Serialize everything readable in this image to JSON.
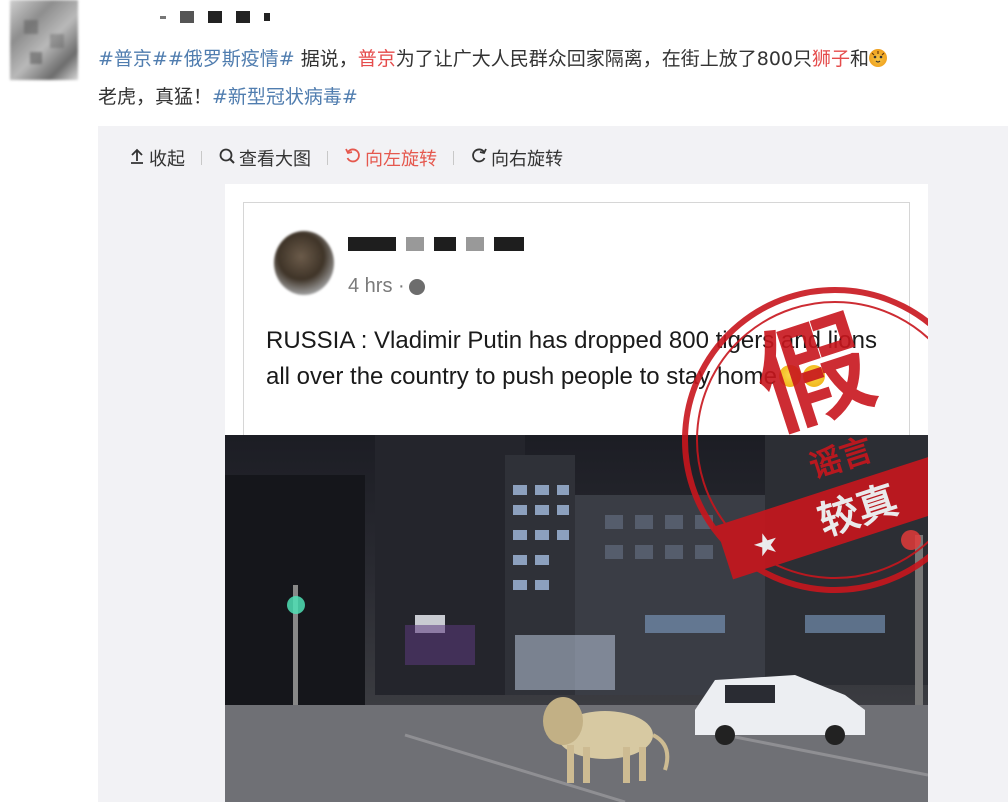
{
  "post": {
    "topic1": "#普京#",
    "topic2": "#俄罗斯疫情#",
    "text1": " 据说，",
    "kw1": "普京",
    "text2": "为了让广大人民群众回家隔离，在街上放了800只",
    "kw2": "狮子",
    "text3": "和",
    "text4": "老虎，真猛！",
    "topic3": "#新型冠状病毒#"
  },
  "toolbar": {
    "collapse_label": "收起",
    "view_large_label": "查看大图",
    "rotate_left_label": "向左旋转",
    "rotate_right_label": "向右旋转"
  },
  "fb_post": {
    "time": "4 hrs ·",
    "body": "RUSSIA : Vladimir Putin has dropped 800 tigers and lions all over the country to push people to stay home"
  },
  "stamp": {
    "main": "假",
    "sub": "谣言",
    "bottom": "较真"
  },
  "colors": {
    "topic_blue": "#507daf",
    "keyword_red": "#e54c4c",
    "stamp_red": "#c8161d",
    "active_tool": "#e5584e"
  },
  "icons": {
    "collapse": "arrow-up-icon",
    "view_large": "magnifier-icon",
    "rotate_left": "rotate-left-icon",
    "rotate_right": "rotate-right-icon"
  }
}
